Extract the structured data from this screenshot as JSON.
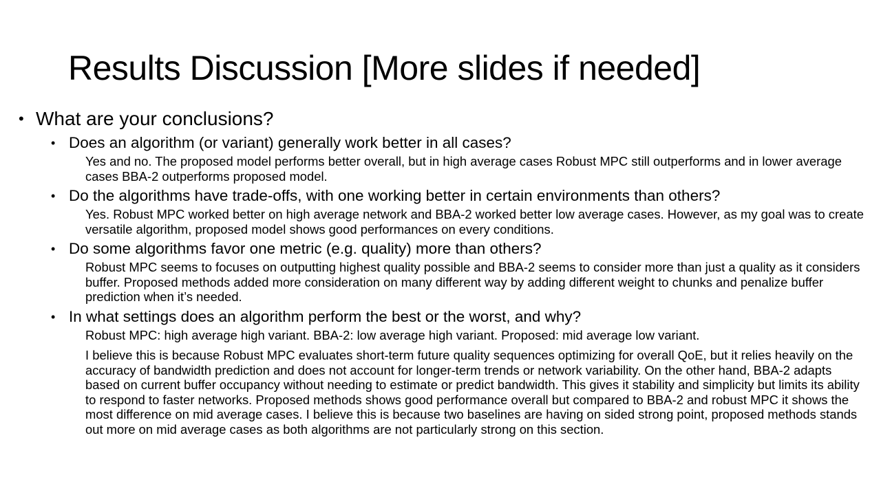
{
  "slide": {
    "title": "Results Discussion [More slides if needed]",
    "bullet": "•",
    "main_question": "What are your conclusions?",
    "sections": [
      {
        "question": "Does an algorithm (or variant) generally work better in all cases?",
        "answers": [
          "Yes and no. The proposed model performs better overall, but in high average cases Robust MPC still outperforms and in lower average cases BBA-2 outperforms proposed model."
        ]
      },
      {
        "question": "Do the algorithms have trade-offs, with one working better in certain environments than others?",
        "answers": [
          "Yes. Robust MPC worked better on high average network and BBA-2 worked better low average cases. However, as my goal was to create versatile algorithm, proposed model shows good performances on every conditions."
        ]
      },
      {
        "question": "Do some algorithms favor one metric (e.g. quality) more than others?",
        "answers": [
          "Robust MPC seems to focuses on outputting highest quality possible and BBA-2 seems to consider more than just a quality as it considers buffer. Proposed methods added more consideration on many different way by adding different weight to chunks and penalize buffer prediction when it’s needed."
        ]
      },
      {
        "question": "In what settings does an algorithm perform the best or the worst, and why?",
        "answers": [
          "Robust MPC: high average high variant. BBA-2: low average high variant. Proposed: mid average low variant.",
          "I believe this is because Robust MPC evaluates short-term future quality sequences optimizing for overall QoE, but it relies heavily on the accuracy of bandwidth prediction and does not account for longer-term trends or network variability. On the other hand, BBA-2 adapts based on current buffer occupancy without needing to estimate or predict bandwidth. This gives it stability and simplicity but limits its ability to respond to faster networks. Proposed methods shows good performance overall but compared to BBA-2 and robust MPC it shows the most difference on mid average cases. I believe this is because two baselines are having on sided strong point, proposed methods stands out more on mid average cases as both algorithms are not particularly strong on this section."
        ]
      }
    ]
  }
}
